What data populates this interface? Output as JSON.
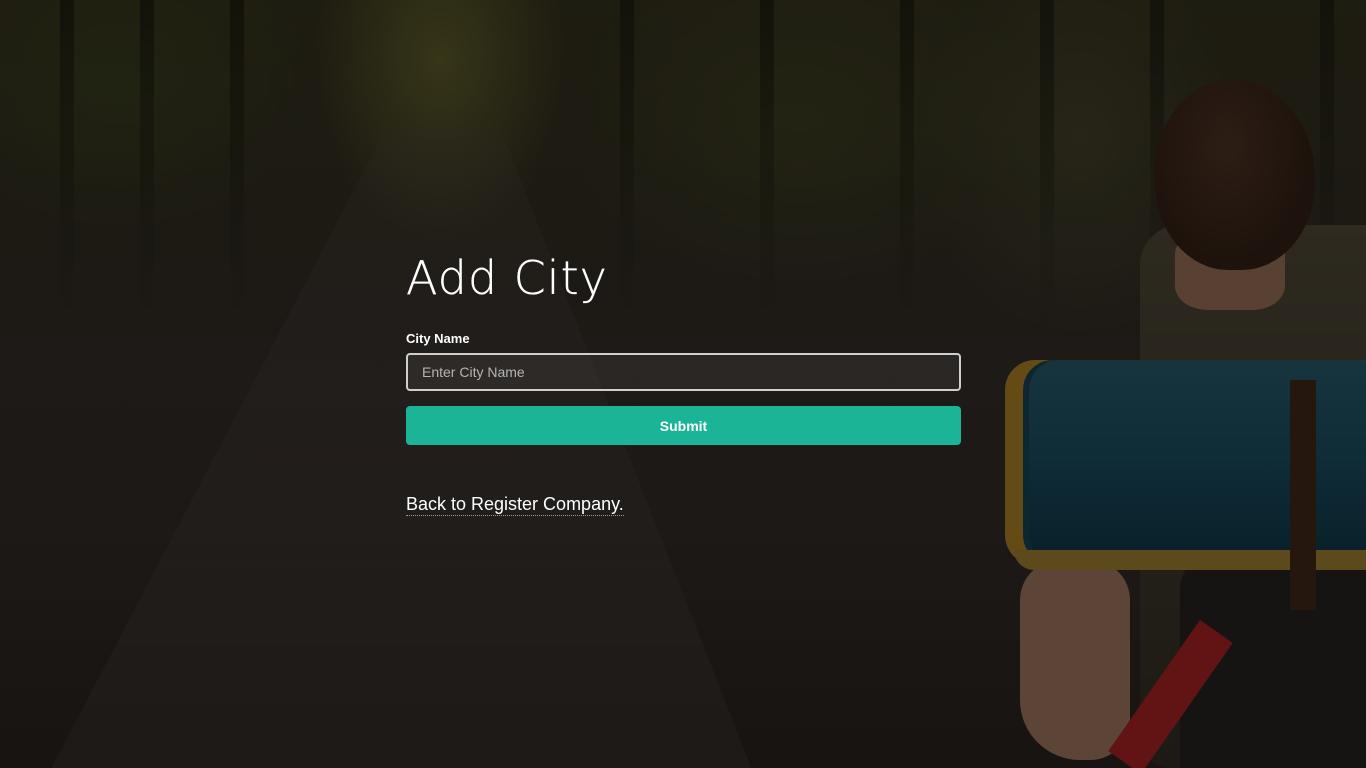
{
  "page": {
    "title": "Add City"
  },
  "form": {
    "city_name_label": "City Name",
    "city_name_value": "",
    "city_name_placeholder": "Enter City Name",
    "submit_label": "Submit"
  },
  "links": {
    "back_label": "Back to Register Company."
  },
  "colors": {
    "accent": "#1cb496",
    "text": "#ffffff",
    "overlay": "rgba(0,0,0,0.5)"
  }
}
